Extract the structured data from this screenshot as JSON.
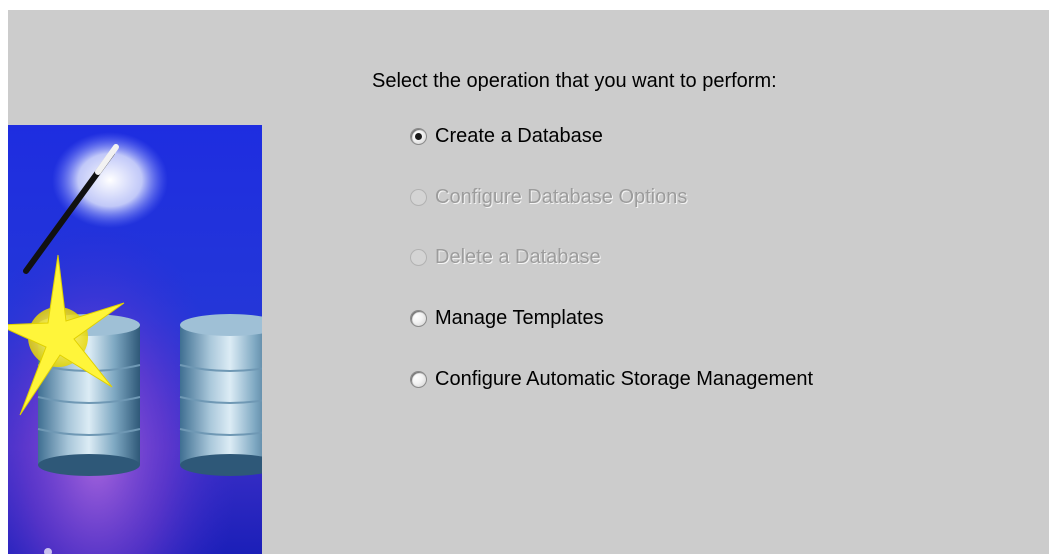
{
  "page": {
    "prompt": "Select the operation that you want to perform:"
  },
  "options": [
    {
      "label": "Create a Database",
      "selected": true,
      "enabled": true
    },
    {
      "label": "Configure Database Options",
      "selected": false,
      "enabled": false
    },
    {
      "label": "Delete a Database",
      "selected": false,
      "enabled": false
    },
    {
      "label": "Manage Templates",
      "selected": false,
      "enabled": true
    },
    {
      "label": "Configure Automatic Storage Management",
      "selected": false,
      "enabled": true
    }
  ],
  "colors": {
    "panel_background": "#cccccc",
    "disabled_text": "#9c9c9c",
    "illustration_blue": "#1e2de0",
    "checkmark_red": "#d31d1d"
  },
  "illustration": {
    "icons": [
      "magic-wand-icon",
      "sparkle-star-icon",
      "database-cylinder-icon",
      "checklist-icon"
    ]
  }
}
